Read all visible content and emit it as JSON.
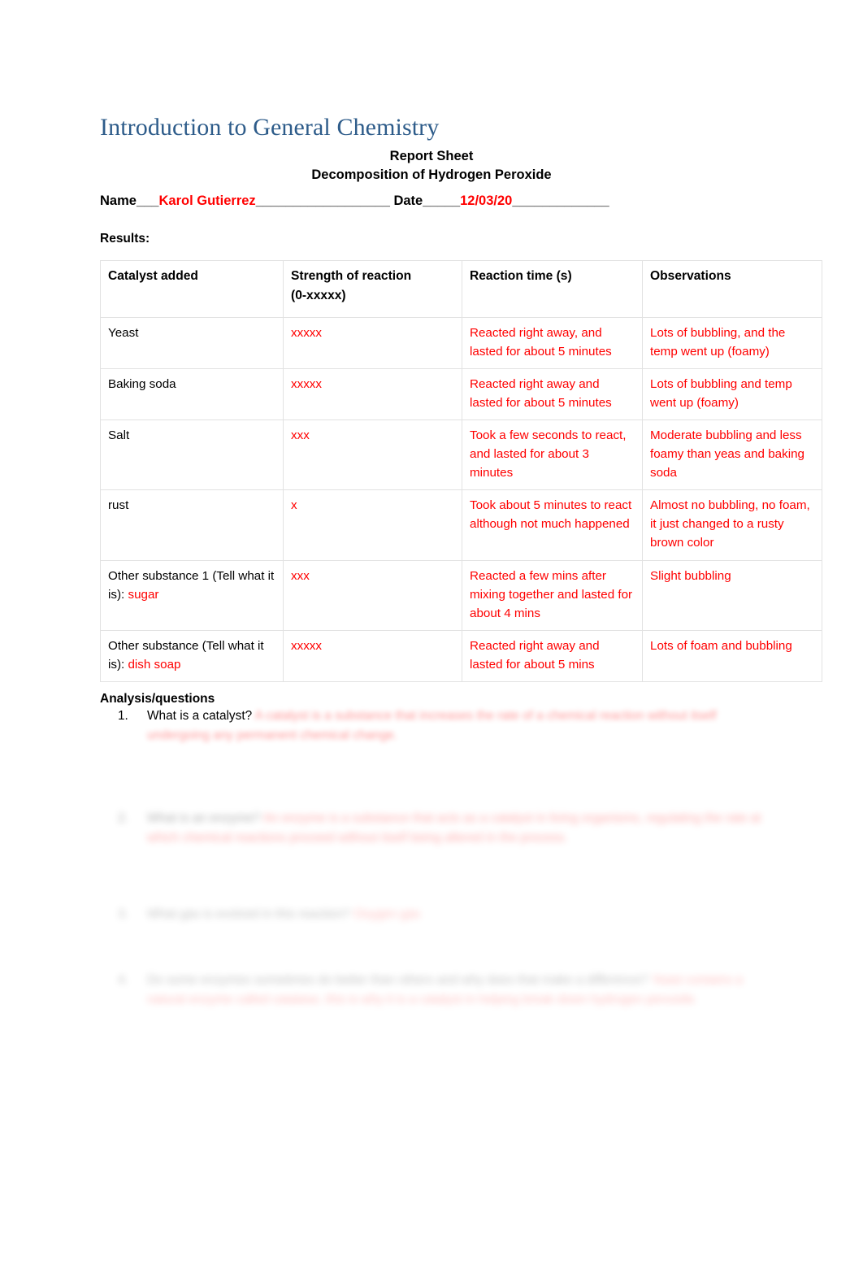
{
  "document": {
    "title": "Introduction to General Chemistry",
    "report_sheet_label": "Report Sheet",
    "experiment_title": "Decomposition of Hydrogen Peroxide",
    "name_label": "Name___",
    "name_value": "Karol Gutierrez",
    "name_rule": "__________________",
    "date_label": "Date_____",
    "date_value": "12/03/20",
    "date_rule": "_____________",
    "results_label": "Results:",
    "analysis_label": "Analysis/questions",
    "title_color": "#2E5C8A",
    "answer_color": "#FF0000"
  },
  "table": {
    "headers": [
      "Catalyst added",
      "Strength of reaction (0-xxxxx)",
      "Reaction time (s)",
      "Observations"
    ],
    "header_col2_line1": "Strength of reaction",
    "header_col2_line2": "(0-xxxxx)",
    "rows": [
      {
        "catalyst_prefix": "Yeast",
        "catalyst_value": "",
        "strength": "xxxxx",
        "reaction_time": "Reacted right away, and lasted for about 5 minutes",
        "observations": "Lots of bubbling, and the temp went up (foamy)"
      },
      {
        "catalyst_prefix": "Baking soda",
        "catalyst_value": "",
        "strength": "xxxxx",
        "reaction_time": "Reacted right away and lasted for about 5 minutes",
        "observations": "Lots of bubbling and temp went up (foamy)"
      },
      {
        "catalyst_prefix": "Salt",
        "catalyst_value": "",
        "strength": "xxx",
        "reaction_time": "Took a few seconds to react, and lasted for about 3 minutes",
        "observations": "Moderate bubbling and less foamy than yeas and baking soda"
      },
      {
        "catalyst_prefix": "rust",
        "catalyst_value": "",
        "strength": "x",
        "reaction_time": "Took about 5 minutes to react although not much happened",
        "observations": "Almost no bubbling, no foam, it just changed to a rusty brown color"
      },
      {
        "catalyst_prefix": "Other substance 1 (Tell what it is): ",
        "catalyst_value": "sugar",
        "strength": "xxx",
        "reaction_time": "Reacted a few mins after mixing together and lasted for about 4 mins",
        "observations": "Slight bubbling"
      },
      {
        "catalyst_prefix": "Other substance  (Tell what it is): ",
        "catalyst_value": "dish soap",
        "strength": "xxxxx",
        "reaction_time": "Reacted right away and lasted for about 5 mins",
        "observations": "Lots of foam and bubbling"
      }
    ]
  },
  "questions": [
    {
      "number": "1.",
      "text": "What is a catalyst?",
      "answer": "A catalyst is a substance that increases the rate of a chemical reaction without itself undergoing any permanent chemical change.",
      "text_redacted": false,
      "answer_redacted": true
    },
    {
      "number": "2.",
      "text": "What is an enzyme?",
      "answer": "An enzyme is a substance that acts as a catalyst in living organisms, regulating the rate at which chemical reactions proceed without itself being altered in the process.",
      "text_redacted": true,
      "answer_redacted": true
    },
    {
      "number": "3.",
      "text": "What gas is evolved in this reaction?",
      "answer": "Oxygen gas",
      "text_redacted": true,
      "answer_redacted": true
    },
    {
      "number": "4.",
      "text": "Do some enzymes sometimes do better than others and why does that make a difference?",
      "answer": "Yeast contains a natural enzyme called catalase, this is why it is a catalyst in helping break down hydrogen peroxide.",
      "text_redacted": true,
      "answer_redacted": true
    }
  ]
}
